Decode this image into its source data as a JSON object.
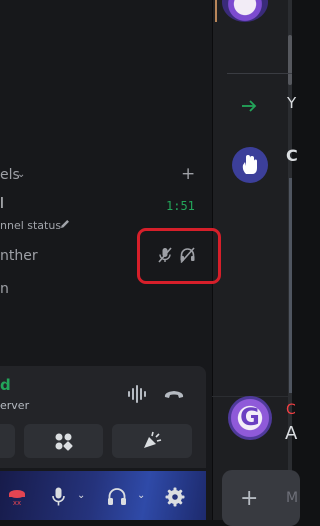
{
  "channel_list": {
    "category_label": "els",
    "voice_channel_name": "l",
    "timer": "1:51",
    "status_label": "nnel status",
    "members": [
      "nther",
      "n"
    ]
  },
  "voice_panel": {
    "status": "d",
    "server": "erver"
  },
  "chat": {
    "cut_off_header_letter": "Y",
    "cut_off_author_letter": "C",
    "cut_off_username": "C",
    "cut_off_message": "A",
    "cut_off_input": "M",
    "avatar_letter": "G"
  },
  "colors": {
    "accent_red": "#d61f2a",
    "voice_green": "#23a55a"
  }
}
